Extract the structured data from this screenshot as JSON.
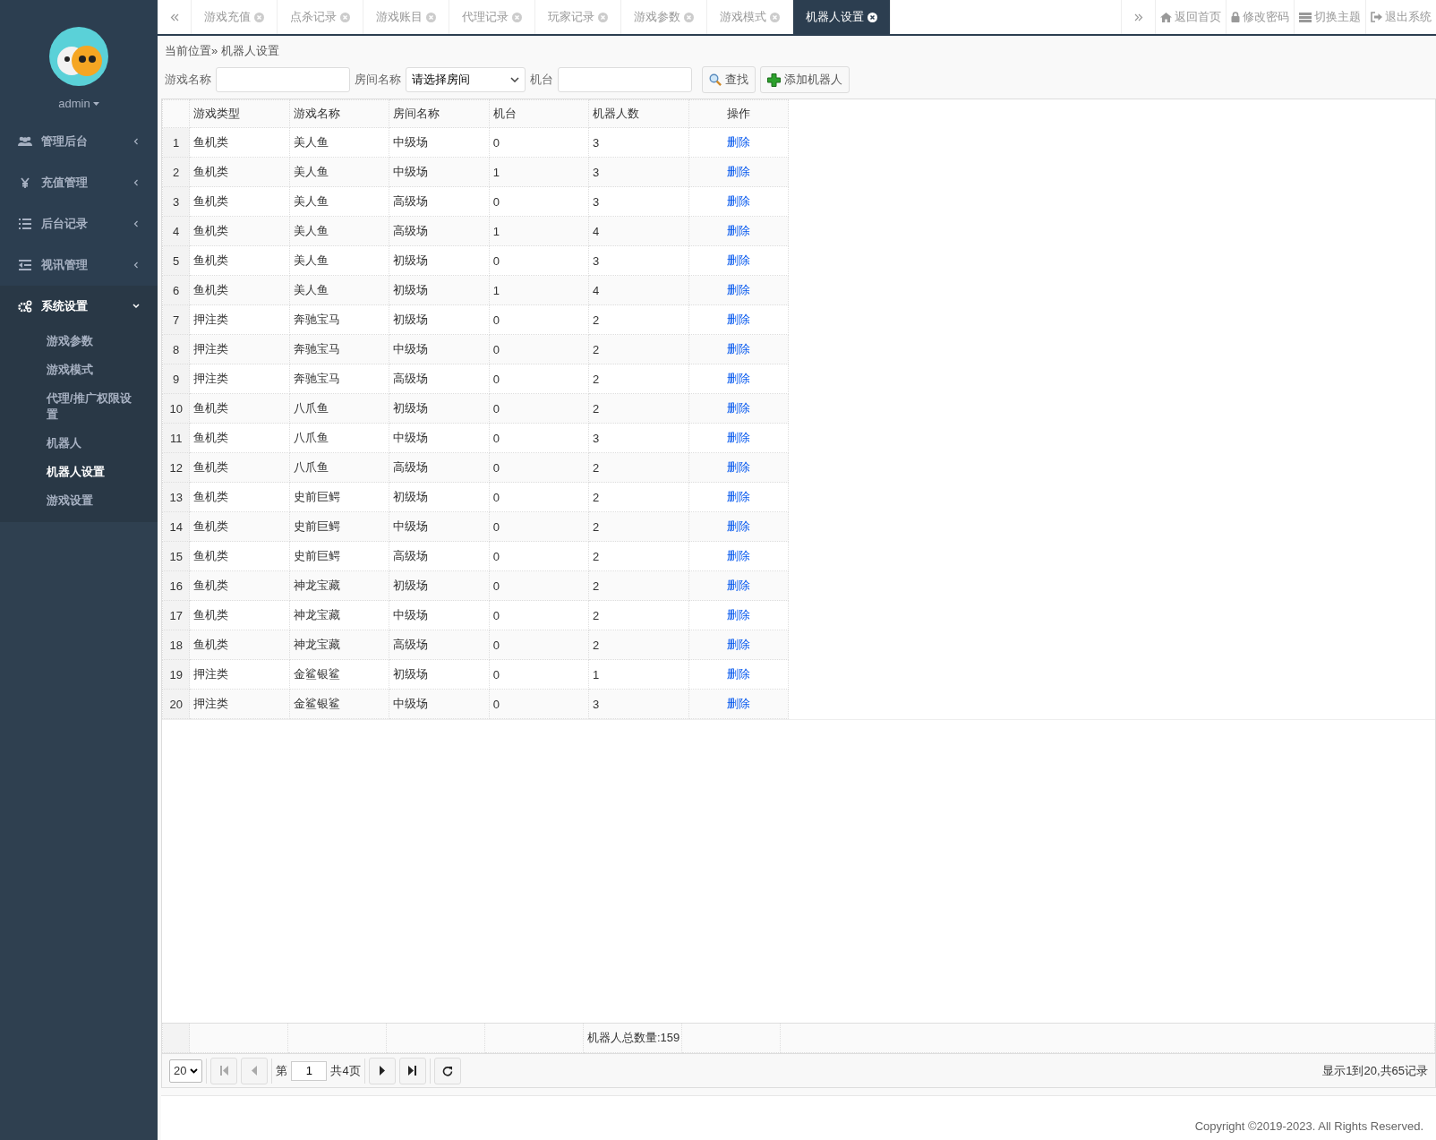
{
  "sidebar": {
    "user": "admin",
    "menu": [
      {
        "label": "管理后台",
        "expanded": false
      },
      {
        "label": "充值管理",
        "expanded": false
      },
      {
        "label": "后台记录",
        "expanded": false
      },
      {
        "label": "视讯管理",
        "expanded": false
      },
      {
        "label": "系统设置",
        "expanded": true,
        "children": [
          {
            "label": "游戏参数",
            "selected": false
          },
          {
            "label": "游戏模式",
            "selected": false
          },
          {
            "label": "代理/推广权限设置",
            "selected": false
          },
          {
            "label": "机器人",
            "selected": false
          },
          {
            "label": "机器人设置",
            "selected": true
          },
          {
            "label": "游戏设置",
            "selected": false
          }
        ]
      }
    ]
  },
  "tabs": [
    {
      "label": "游戏充值",
      "selected": false
    },
    {
      "label": "点杀记录",
      "selected": false
    },
    {
      "label": "游戏账目",
      "selected": false
    },
    {
      "label": "代理记录",
      "selected": false
    },
    {
      "label": "玩家记录",
      "selected": false
    },
    {
      "label": "游戏参数",
      "selected": false
    },
    {
      "label": "游戏模式",
      "selected": false
    },
    {
      "label": "机器人设置",
      "selected": true
    }
  ],
  "top_links": [
    "返回首页",
    "修改密码",
    "切换主题",
    "退出系统"
  ],
  "breadcrumb": "当前位置» 机器人设置",
  "filters": {
    "game_label": "游戏名称",
    "room_label": "房间名称",
    "room_value": "请选择房间",
    "machine_label": "机台",
    "search_button": "查找",
    "add_button": "添加机器人"
  },
  "table": {
    "columns": [
      "游戏类型",
      "游戏名称",
      "房间名称",
      "机台",
      "机器人数",
      "操作"
    ],
    "rows": [
      {
        "index": "1",
        "type": "鱼机类",
        "game": "美人鱼",
        "room": "中级场",
        "machine": "0",
        "robots": "3",
        "action": "删除"
      },
      {
        "index": "2",
        "type": "鱼机类",
        "game": "美人鱼",
        "room": "中级场",
        "machine": "1",
        "robots": "3",
        "action": "删除"
      },
      {
        "index": "3",
        "type": "鱼机类",
        "game": "美人鱼",
        "room": "高级场",
        "machine": "0",
        "robots": "3",
        "action": "删除"
      },
      {
        "index": "4",
        "type": "鱼机类",
        "game": "美人鱼",
        "room": "高级场",
        "machine": "1",
        "robots": "4",
        "action": "删除"
      },
      {
        "index": "5",
        "type": "鱼机类",
        "game": "美人鱼",
        "room": "初级场",
        "machine": "0",
        "robots": "3",
        "action": "删除"
      },
      {
        "index": "6",
        "type": "鱼机类",
        "game": "美人鱼",
        "room": "初级场",
        "machine": "1",
        "robots": "4",
        "action": "删除"
      },
      {
        "index": "7",
        "type": "押注类",
        "game": "奔驰宝马",
        "room": "初级场",
        "machine": "0",
        "robots": "2",
        "action": "删除"
      },
      {
        "index": "8",
        "type": "押注类",
        "game": "奔驰宝马",
        "room": "中级场",
        "machine": "0",
        "robots": "2",
        "action": "删除"
      },
      {
        "index": "9",
        "type": "押注类",
        "game": "奔驰宝马",
        "room": "高级场",
        "machine": "0",
        "robots": "2",
        "action": "删除"
      },
      {
        "index": "10",
        "type": "鱼机类",
        "game": "八爪鱼",
        "room": "初级场",
        "machine": "0",
        "robots": "2",
        "action": "删除"
      },
      {
        "index": "11",
        "type": "鱼机类",
        "game": "八爪鱼",
        "room": "中级场",
        "machine": "0",
        "robots": "3",
        "action": "删除"
      },
      {
        "index": "12",
        "type": "鱼机类",
        "game": "八爪鱼",
        "room": "高级场",
        "machine": "0",
        "robots": "2",
        "action": "删除"
      },
      {
        "index": "13",
        "type": "鱼机类",
        "game": "史前巨鳄",
        "room": "初级场",
        "machine": "0",
        "robots": "2",
        "action": "删除"
      },
      {
        "index": "14",
        "type": "鱼机类",
        "game": "史前巨鳄",
        "room": "中级场",
        "machine": "0",
        "robots": "2",
        "action": "删除"
      },
      {
        "index": "15",
        "type": "鱼机类",
        "game": "史前巨鳄",
        "room": "高级场",
        "machine": "0",
        "robots": "2",
        "action": "删除"
      },
      {
        "index": "16",
        "type": "鱼机类",
        "game": "神龙宝藏",
        "room": "初级场",
        "machine": "0",
        "robots": "2",
        "action": "删除"
      },
      {
        "index": "17",
        "type": "鱼机类",
        "game": "神龙宝藏",
        "room": "中级场",
        "machine": "0",
        "robots": "2",
        "action": "删除"
      },
      {
        "index": "18",
        "type": "鱼机类",
        "game": "神龙宝藏",
        "room": "高级场",
        "machine": "0",
        "robots": "2",
        "action": "删除"
      },
      {
        "index": "19",
        "type": "押注类",
        "game": "金鲨银鲨",
        "room": "初级场",
        "machine": "0",
        "robots": "1",
        "action": "删除"
      },
      {
        "index": "20",
        "type": "押注类",
        "game": "金鲨银鲨",
        "room": "中级场",
        "machine": "0",
        "robots": "3",
        "action": "删除"
      }
    ],
    "footer_total": "机器人总数量:159"
  },
  "pagination": {
    "page_size": "20",
    "page_prefix": "第",
    "page": "1",
    "page_total": "共4页",
    "summary": "显示1到20,共65记录"
  },
  "copyright": "Copyright ©2019-2023. All Rights Reserved."
}
